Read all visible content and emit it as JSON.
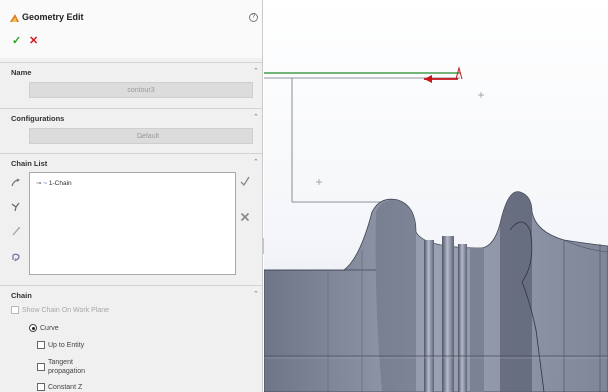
{
  "property_manager": {
    "title": "Geometry Edit",
    "help_glyph": "?",
    "ok_glyph": "✓",
    "cancel_glyph": "✕",
    "name_section": {
      "label": "Name",
      "value": "contour3"
    },
    "config_section": {
      "label": "Configurations",
      "selected": "Default"
    },
    "chain_list_section": {
      "label": "Chain List",
      "items": [
        {
          "twisty": "⊸",
          "label": "1-Chain"
        }
      ]
    },
    "chain_section": {
      "label": "Chain",
      "show_on_plane": "Show Chain On Work Plane",
      "curve": "Curve",
      "up_to_entity": "Up to Entity",
      "tangent_line1": "Tangent",
      "tangent_line2": "propagation",
      "constant_z": "Constant Z"
    }
  },
  "icons": {
    "title": "geometry-edit-icon",
    "help": "help-icon",
    "ok": "ok-checkmark-icon",
    "cancel": "cancel-x-icon",
    "chain_tools": [
      "add-chain-icon",
      "select-chain-icon",
      "edit-chain-icon",
      "flip-direction-icon",
      "accept-chain-icon",
      "delete-chain-icon"
    ]
  },
  "colors": {
    "panel_bg": "#f0f0f0",
    "model_body": "#8f96a8",
    "model_shadow": "#555c6c",
    "ok_green": "#2aa523",
    "cancel_red": "#d11a1a",
    "contour_green": "#1e8a2a",
    "contour_red": "#c8161c"
  }
}
